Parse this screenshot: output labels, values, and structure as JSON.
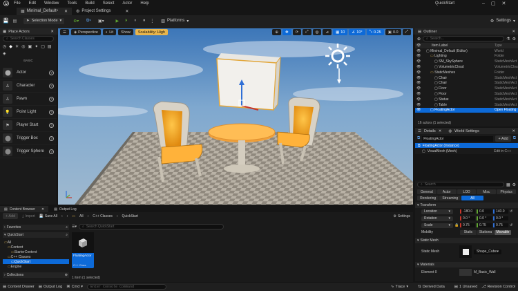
{
  "menu": [
    "File",
    "Edit",
    "Window",
    "Tools",
    "Build",
    "Select",
    "Actor",
    "Help"
  ],
  "window_title": "QuickStart",
  "tabs": {
    "level": "Minimal_Default•",
    "project_settings": "Project Settings"
  },
  "toolbar": {
    "mode": "Selection Mode",
    "platforms": "Platforms",
    "settings": "Settings"
  },
  "place_actors": {
    "title": "Place Actors",
    "search_placeholder": "Search Classes",
    "category": "BASIC",
    "items": [
      "Actor",
      "Character",
      "Pawn",
      "Point Light",
      "Player Start",
      "Trigger Box",
      "Trigger Sphere"
    ]
  },
  "viewport": {
    "perspective": "Perspective",
    "lit": "Lit",
    "show": "Show",
    "scalability": "Scalability: High",
    "grid_snap": "10",
    "rot_snap": "10°",
    "scale_snap": "0.25",
    "cam_speed": "0.0"
  },
  "outliner": {
    "title": "Outliner",
    "search_placeholder": "Search...",
    "col_label": "Item Label",
    "col_type": "Type",
    "rows": [
      {
        "label": "Minimal_Default (Editor)",
        "type": "World",
        "indent": 1
      },
      {
        "label": "Lighting",
        "type": "Folder",
        "indent": 2
      },
      {
        "label": "SM_SkySphere",
        "type": "StaticMeshAct",
        "indent": 3
      },
      {
        "label": "VolumetricCloud",
        "type": "VolumetricClou",
        "indent": 3
      },
      {
        "label": "StaticMeshes",
        "type": "Folder",
        "indent": 2
      },
      {
        "label": "Chair",
        "type": "StaticMeshAct",
        "indent": 3
      },
      {
        "label": "Chair",
        "type": "StaticMeshAct",
        "indent": 3
      },
      {
        "label": "Floor",
        "type": "StaticMeshAct",
        "indent": 3
      },
      {
        "label": "Floor",
        "type": "StaticMeshAct",
        "indent": 3
      },
      {
        "label": "Statue",
        "type": "StaticMeshAct",
        "indent": 3
      },
      {
        "label": "Table",
        "type": "StaticMeshAct",
        "indent": 3
      },
      {
        "label": "FloatingActor",
        "type": "Open Floating",
        "indent": 2,
        "selected": true
      }
    ],
    "status": "16 actors (1 selected)"
  },
  "details": {
    "title": "Details",
    "world_settings": "World Settings",
    "actor_name": "FloatingActor",
    "add": "+ Add",
    "instance": "FloatingActor (Instance)",
    "component": "VisualMesh (Mesh)",
    "edit_cpp": "Edit in C++",
    "search_placeholder": "Search",
    "filters": [
      "General",
      "Actor",
      "LOD",
      "Misc",
      "Physics",
      "Rendering",
      "Streaming",
      "All"
    ],
    "transform_label": "Transform",
    "location_label": "Location",
    "location": [
      "-180.0",
      "0.0",
      "140.0"
    ],
    "rotation_label": "Rotation",
    "rotation": [
      "0.0 °",
      "0.0 °",
      "0.0 °"
    ],
    "scale_label": "Scale",
    "scale": [
      "0.75",
      "0.75",
      "0.75"
    ],
    "mobility_label": "Mobility",
    "mobility": [
      "Static",
      "Stationa",
      "Movable"
    ],
    "static_mesh_section": "Static Mesh",
    "static_mesh_label": "Static Mesh",
    "static_mesh_value": "Shape_Cube",
    "materials_section": "Materials",
    "element_label": "Element 0",
    "material_value": "M_Basic_Wall"
  },
  "content_browser": {
    "title": "Content Browser",
    "output_log": "Output Log",
    "add": "+ Add",
    "import": "Import",
    "save_all": "Save All",
    "path": [
      "All",
      "C++ Classes",
      "QuickStart"
    ],
    "settings": "Settings",
    "favorites": "Favorites",
    "project": "QuickStart",
    "search_placeholder": "Search QuickStart",
    "tree": [
      {
        "label": "All",
        "indent": 0
      },
      {
        "label": "Content",
        "indent": 1
      },
      {
        "label": "StarterContent",
        "indent": 2
      },
      {
        "label": "C++ Classes",
        "indent": 1
      },
      {
        "label": "QuickStart",
        "indent": 2,
        "selected": true
      },
      {
        "label": "Engine",
        "indent": 1
      }
    ],
    "asset_name": "FloatingActor",
    "asset_type": "C++ Class",
    "status": "1 item (1 selected)",
    "collections": "Collections"
  },
  "statusbar": {
    "content_drawer": "Content Drawer",
    "output_log": "Output Log",
    "cmd": "Cmd",
    "console_placeholder": "Enter Console Command",
    "trace": "Trace",
    "derived_data": "Derived Data",
    "unsaved": "1 Unsaved",
    "revision_control": "Revision Control"
  },
  "colors": {
    "accent": "#0d6ad8",
    "selection": "#0d6ad8",
    "scalability": "#e9b54b",
    "x_axis": "#c8372d",
    "y_axis": "#5fa531",
    "z_axis": "#2f6fd6"
  }
}
